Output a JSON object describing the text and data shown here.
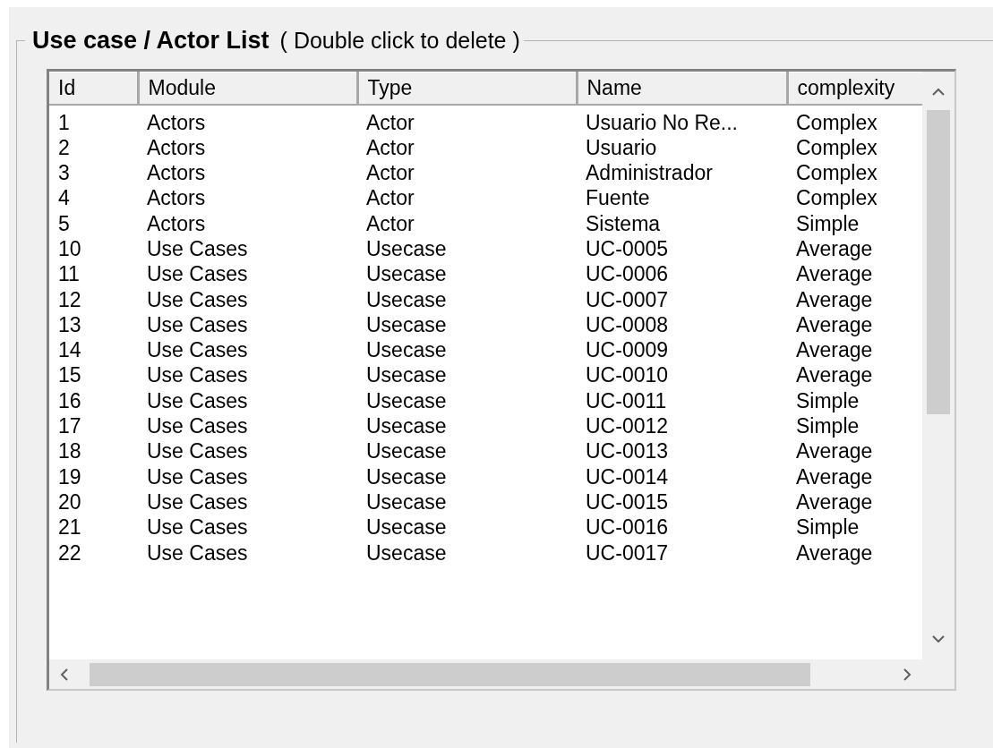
{
  "group": {
    "title": "Use case / Actor List",
    "hint": "( Double click to delete )"
  },
  "table": {
    "columns": [
      "Id",
      "Module",
      "Type",
      "Name",
      "complexity"
    ],
    "rows": [
      [
        "1",
        "Actors",
        "Actor",
        "Usuario No Re...",
        "Complex"
      ],
      [
        "2",
        "Actors",
        "Actor",
        "Usuario",
        "Complex"
      ],
      [
        "3",
        "Actors",
        "Actor",
        "Administrador",
        "Complex"
      ],
      [
        "4",
        "Actors",
        "Actor",
        "Fuente",
        "Complex"
      ],
      [
        "5",
        "Actors",
        "Actor",
        "Sistema",
        "Simple"
      ],
      [
        "10",
        "Use Cases",
        "Usecase",
        "UC-0005",
        "Average"
      ],
      [
        "11",
        "Use Cases",
        "Usecase",
        "UC-0006",
        "Average"
      ],
      [
        "12",
        "Use Cases",
        "Usecase",
        "UC-0007",
        "Average"
      ],
      [
        "13",
        "Use Cases",
        "Usecase",
        "UC-0008",
        "Average"
      ],
      [
        "14",
        "Use Cases",
        "Usecase",
        "UC-0009",
        "Average"
      ],
      [
        "15",
        "Use Cases",
        "Usecase",
        "UC-0010",
        "Average"
      ],
      [
        "16",
        "Use Cases",
        "Usecase",
        "UC-0011",
        "Simple"
      ],
      [
        "17",
        "Use Cases",
        "Usecase",
        "UC-0012",
        "Simple"
      ],
      [
        "18",
        "Use Cases",
        "Usecase",
        "UC-0013",
        "Average"
      ],
      [
        "19",
        "Use Cases",
        "Usecase",
        "UC-0014",
        "Average"
      ],
      [
        "20",
        "Use Cases",
        "Usecase",
        "UC-0015",
        "Average"
      ],
      [
        "21",
        "Use Cases",
        "Usecase",
        "UC-0016",
        "Simple"
      ],
      [
        "22",
        "Use Cases",
        "Usecase",
        "UC-0017",
        "Average"
      ]
    ]
  }
}
